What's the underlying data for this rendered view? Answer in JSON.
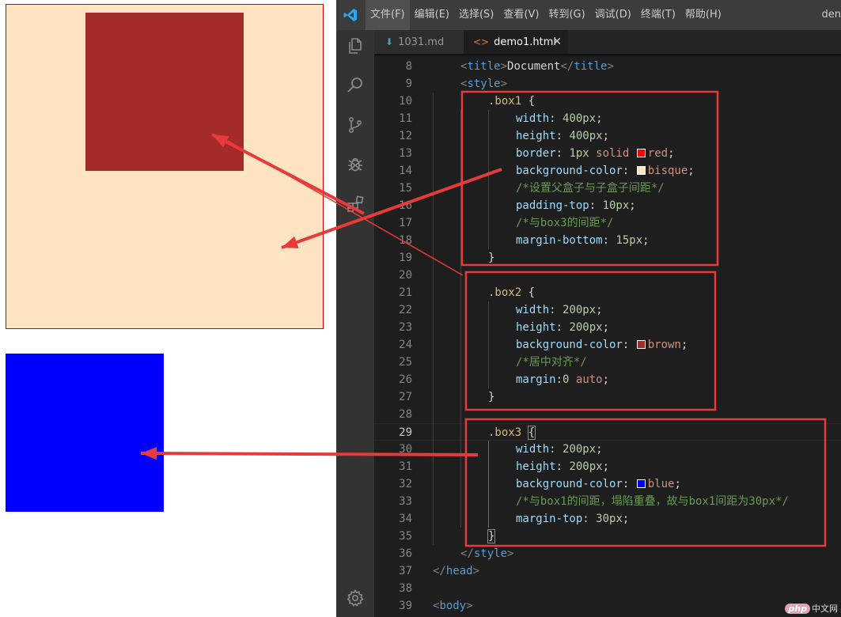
{
  "preview": {
    "box1_color": "#ffe4c4",
    "box1_border": "#cc0000",
    "box2_color": "#a52a2a",
    "box3_color": "#0000ff"
  },
  "titlebar": {
    "menu": [
      {
        "label": "文件(F)"
      },
      {
        "label": "编辑(E)"
      },
      {
        "label": "选择(S)"
      },
      {
        "label": "查看(V)"
      },
      {
        "label": "转到(G)"
      },
      {
        "label": "调试(D)"
      },
      {
        "label": "终端(T)"
      },
      {
        "label": "帮助(H)"
      }
    ],
    "right_text": "den"
  },
  "tabs": [
    {
      "label": "1031.md",
      "icon": "markdown-arrow-icon"
    },
    {
      "label": "demo1.html",
      "icon": "html-code-icon",
      "close": "✕"
    }
  ],
  "activity_icons": [
    "files-icon",
    "search-icon",
    "source-control-icon",
    "debug-icon",
    "extensions-icon",
    "gear-icon"
  ],
  "editor": {
    "current_line": "29",
    "lines": [
      {
        "n": "8",
        "t": [
          {
            "c": "c-punc",
            "s": "<"
          },
          {
            "c": "c-tag",
            "s": "title"
          },
          {
            "c": "c-punc",
            "s": ">"
          },
          {
            "c": "c-text",
            "s": "Document"
          },
          {
            "c": "c-punc",
            "s": "</"
          },
          {
            "c": "c-tag",
            "s": "title"
          },
          {
            "c": "c-punc",
            "s": ">"
          }
        ]
      },
      {
        "n": "9",
        "t": [
          {
            "c": "c-punc",
            "s": "<"
          },
          {
            "c": "c-tag",
            "s": "style"
          },
          {
            "c": "c-punc",
            "s": ">"
          }
        ]
      },
      {
        "n": "10",
        "t": [
          {
            "c": "c-sel",
            "s": ".box1"
          },
          {
            "c": "c-text",
            "s": " {"
          }
        ]
      },
      {
        "n": "11",
        "t": [
          {
            "c": "c-prop",
            "s": "width"
          },
          {
            "c": "c-text",
            "s": ": "
          },
          {
            "c": "c-num",
            "s": "400px"
          },
          {
            "c": "c-text",
            "s": ";"
          }
        ]
      },
      {
        "n": "12",
        "t": [
          {
            "c": "c-prop",
            "s": "height"
          },
          {
            "c": "c-text",
            "s": ": "
          },
          {
            "c": "c-num",
            "s": "400px"
          },
          {
            "c": "c-text",
            "s": ";"
          }
        ]
      },
      {
        "n": "13",
        "t": [
          {
            "c": "c-prop",
            "s": "border"
          },
          {
            "c": "c-text",
            "s": ": "
          },
          {
            "c": "c-num",
            "s": "1px"
          },
          {
            "c": "c-text",
            "s": " "
          },
          {
            "c": "c-val",
            "s": "solid"
          },
          {
            "c": "c-text",
            "s": " "
          },
          {
            "swatch": "#ff0000"
          },
          {
            "c": "c-val",
            "s": "red"
          },
          {
            "c": "c-text",
            "s": ";"
          }
        ]
      },
      {
        "n": "14",
        "t": [
          {
            "c": "c-prop",
            "s": "background-color"
          },
          {
            "c": "c-text",
            "s": ": "
          },
          {
            "swatch": "#ffe4c4"
          },
          {
            "c": "c-val",
            "s": "bisque"
          },
          {
            "c": "c-text",
            "s": ";"
          }
        ]
      },
      {
        "n": "15",
        "t": [
          {
            "c": "c-cmt",
            "s": "/*设置父盒子与子盒子间距*/"
          }
        ]
      },
      {
        "n": "16",
        "t": [
          {
            "c": "c-prop",
            "s": "padding-top"
          },
          {
            "c": "c-text",
            "s": ": "
          },
          {
            "c": "c-num",
            "s": "10px"
          },
          {
            "c": "c-text",
            "s": ";"
          }
        ]
      },
      {
        "n": "17",
        "t": [
          {
            "c": "c-cmt",
            "s": "/*与box3的间距*/"
          }
        ]
      },
      {
        "n": "18",
        "t": [
          {
            "c": "c-prop",
            "s": "margin-bottom"
          },
          {
            "c": "c-text",
            "s": ": "
          },
          {
            "c": "c-num",
            "s": "15px"
          },
          {
            "c": "c-text",
            "s": ";"
          }
        ]
      },
      {
        "n": "19",
        "t": [
          {
            "c": "c-text",
            "s": "}"
          }
        ]
      },
      {
        "n": "20",
        "t": []
      },
      {
        "n": "21",
        "t": [
          {
            "c": "c-sel",
            "s": ".box2"
          },
          {
            "c": "c-text",
            "s": " {"
          }
        ]
      },
      {
        "n": "22",
        "t": [
          {
            "c": "c-prop",
            "s": "width"
          },
          {
            "c": "c-text",
            "s": ": "
          },
          {
            "c": "c-num",
            "s": "200px"
          },
          {
            "c": "c-text",
            "s": ";"
          }
        ]
      },
      {
        "n": "23",
        "t": [
          {
            "c": "c-prop",
            "s": "height"
          },
          {
            "c": "c-text",
            "s": ": "
          },
          {
            "c": "c-num",
            "s": "200px"
          },
          {
            "c": "c-text",
            "s": ";"
          }
        ]
      },
      {
        "n": "24",
        "t": [
          {
            "c": "c-prop",
            "s": "background-color"
          },
          {
            "c": "c-text",
            "s": ": "
          },
          {
            "swatch": "#a52a2a"
          },
          {
            "c": "c-val",
            "s": "brown"
          },
          {
            "c": "c-text",
            "s": ";"
          }
        ]
      },
      {
        "n": "25",
        "t": [
          {
            "c": "c-cmt",
            "s": "/*居中对齐*/"
          }
        ]
      },
      {
        "n": "26",
        "t": [
          {
            "c": "c-prop",
            "s": "margin"
          },
          {
            "c": "c-text",
            "s": ":"
          },
          {
            "c": "c-num",
            "s": "0"
          },
          {
            "c": "c-text",
            "s": " "
          },
          {
            "c": "c-val",
            "s": "auto"
          },
          {
            "c": "c-text",
            "s": ";"
          }
        ]
      },
      {
        "n": "27",
        "t": [
          {
            "c": "c-text",
            "s": "}"
          }
        ]
      },
      {
        "n": "28",
        "t": []
      },
      {
        "n": "29",
        "t": [
          {
            "c": "c-sel",
            "s": ".box3"
          },
          {
            "c": "c-text",
            "s": " "
          },
          {
            "c": "c-text bracket-match",
            "s": "{"
          }
        ]
      },
      {
        "n": "30",
        "t": [
          {
            "c": "c-prop",
            "s": "width"
          },
          {
            "c": "c-text",
            "s": ": "
          },
          {
            "c": "c-num",
            "s": "200px"
          },
          {
            "c": "c-text",
            "s": ";"
          }
        ]
      },
      {
        "n": "31",
        "t": [
          {
            "c": "c-prop",
            "s": "height"
          },
          {
            "c": "c-text",
            "s": ": "
          },
          {
            "c": "c-num",
            "s": "200px"
          },
          {
            "c": "c-text",
            "s": ";"
          }
        ]
      },
      {
        "n": "32",
        "t": [
          {
            "c": "c-prop",
            "s": "background-color"
          },
          {
            "c": "c-text",
            "s": ": "
          },
          {
            "swatch": "#0000ff"
          },
          {
            "c": "c-val",
            "s": "blue"
          },
          {
            "c": "c-text",
            "s": ";"
          }
        ]
      },
      {
        "n": "33",
        "t": [
          {
            "c": "c-cmt",
            "s": "/*与box1的间距，塌陷重叠，故与box1间距为30px*/"
          }
        ]
      },
      {
        "n": "34",
        "t": [
          {
            "c": "c-prop",
            "s": "margin-top"
          },
          {
            "c": "c-text",
            "s": ": "
          },
          {
            "c": "c-num",
            "s": "30px"
          },
          {
            "c": "c-text",
            "s": ";"
          }
        ]
      },
      {
        "n": "35",
        "t": [
          {
            "c": "c-text bracket-match",
            "s": "}"
          }
        ]
      },
      {
        "n": "36",
        "t": [
          {
            "c": "c-punc",
            "s": "</"
          },
          {
            "c": "c-tag",
            "s": "style"
          },
          {
            "c": "c-punc",
            "s": ">"
          }
        ]
      },
      {
        "n": "37",
        "t": [
          {
            "c": "c-punc",
            "s": "</"
          },
          {
            "c": "c-tag",
            "s": "head"
          },
          {
            "c": "c-punc",
            "s": ">"
          }
        ]
      },
      {
        "n": "38",
        "t": []
      },
      {
        "n": "39",
        "t": [
          {
            "c": "c-punc",
            "s": "<"
          },
          {
            "c": "c-tag",
            "s": "body"
          },
          {
            "c": "c-punc",
            "s": ">"
          }
        ]
      }
    ]
  },
  "annotation_color": "#e83a3a",
  "watermark": {
    "logo": "php",
    "text": "中文网"
  }
}
